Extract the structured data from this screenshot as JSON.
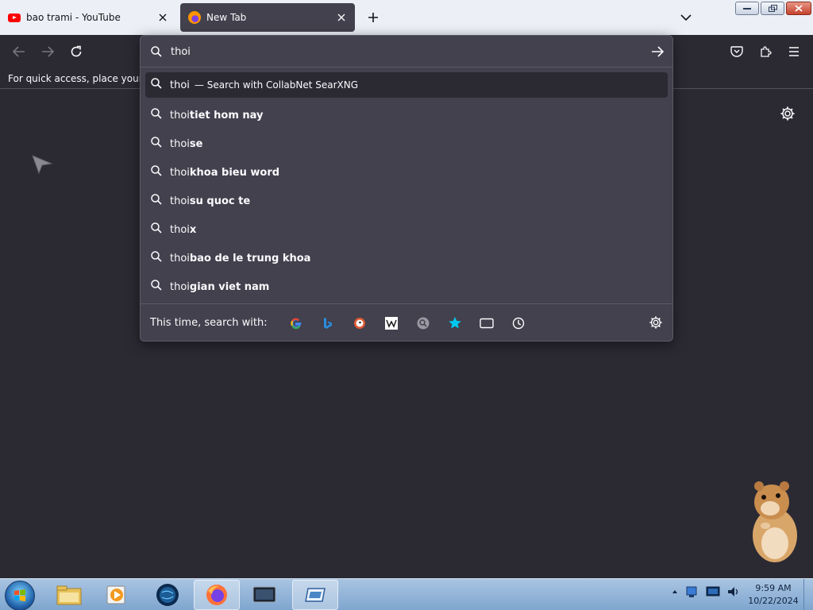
{
  "tabs": [
    {
      "label": "bao trami - YouTube",
      "icon": "youtube-icon",
      "active": false
    },
    {
      "label": "New Tab",
      "icon": "firefox-icon",
      "active": true
    }
  ],
  "bookmarks_bar": {
    "text": "For quick access, place your bookmarks here on the bookmarks toolbar."
  },
  "urlbar": {
    "value": "thoi"
  },
  "suggestions": [
    {
      "prefix": "thoi",
      "bold": "",
      "action": "— Search with CollabNet SearXNG",
      "selected": true
    },
    {
      "prefix": "thoi ",
      "bold": "tiet hom nay",
      "action": "",
      "selected": false
    },
    {
      "prefix": "thoi",
      "bold": "se",
      "action": "",
      "selected": false
    },
    {
      "prefix": "thoi ",
      "bold": "khoa bieu word",
      "action": "",
      "selected": false
    },
    {
      "prefix": "thoi ",
      "bold": "su quoc te",
      "action": "",
      "selected": false
    },
    {
      "prefix": "thoi",
      "bold": "x",
      "action": "",
      "selected": false
    },
    {
      "prefix": "thoi ",
      "bold": "bao de le trung khoa",
      "action": "",
      "selected": false
    },
    {
      "prefix": "thoi ",
      "bold": "gian viet nam",
      "action": "",
      "selected": false
    }
  ],
  "oneoff": {
    "label": "This time, search with:",
    "engines": [
      "google-icon",
      "bing-icon",
      "duckduckgo-icon",
      "wikipedia-icon",
      "searxng-icon",
      "bookmarks-icon",
      "tabs-icon",
      "history-icon"
    ]
  },
  "taskbar": {
    "items": [
      "explorer-icon",
      "media-player-icon",
      "globe-icon",
      "firefox-icon",
      "terminal-icon",
      "remote-icon"
    ],
    "active_item": "firefox-icon"
  },
  "clock": {
    "time": "9:59 AM",
    "date": "10/22/2024"
  },
  "colors": {
    "accent": "#42414d",
    "background": "#2b2a33",
    "text": "#fbfbfe"
  }
}
